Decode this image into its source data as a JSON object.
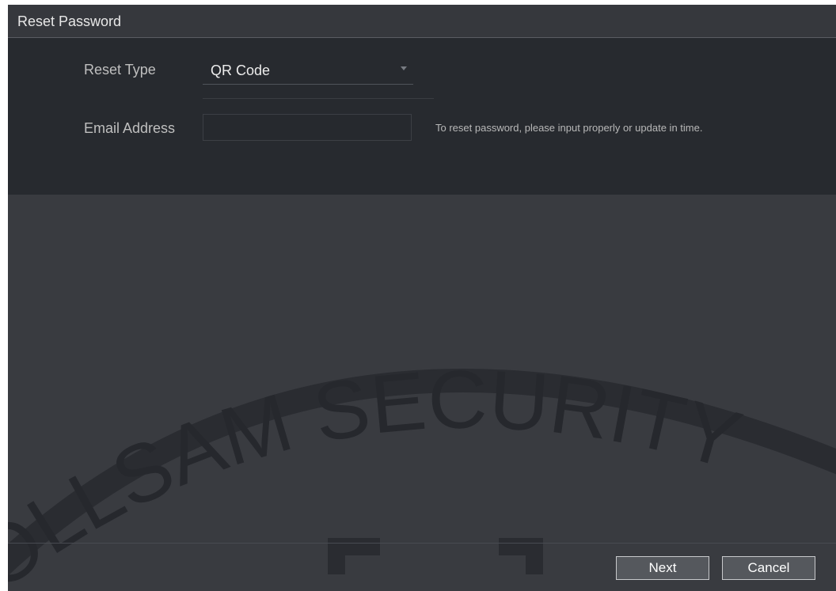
{
  "dialog": {
    "title": "Reset Password"
  },
  "form": {
    "reset_type_label": "Reset Type",
    "reset_type_value": "QR Code",
    "email_label": "Email Address",
    "email_value": "",
    "email_hint": "To reset password, please input properly or update in time."
  },
  "watermark": {
    "text": "OLLSAM SECURITY"
  },
  "buttons": {
    "next": "Next",
    "cancel": "Cancel"
  },
  "colors": {
    "dialog_bg": "#393b40",
    "panel_bg": "#272a2f",
    "button_bg": "#55585d"
  }
}
